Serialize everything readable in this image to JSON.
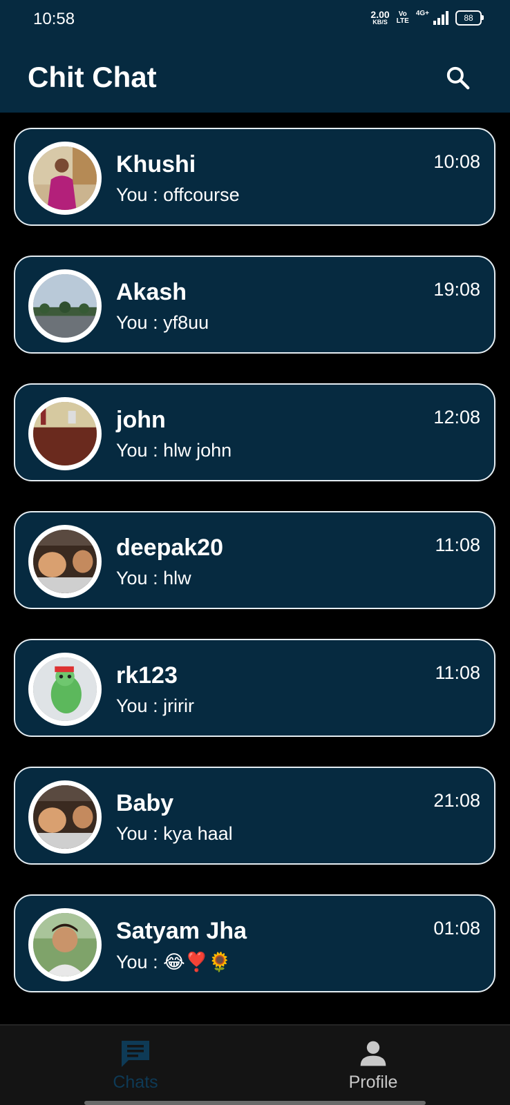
{
  "status_bar": {
    "time": "10:58",
    "net_speed_value": "2.00",
    "net_speed_unit": "KB/S",
    "volte_top": "Vo",
    "volte_bottom": "LTE",
    "network_type": "4G+",
    "battery_level": "88"
  },
  "header": {
    "title": "Chit Chat",
    "search_icon": "search-icon"
  },
  "chats": [
    {
      "name": "Khushi",
      "preview": "You : offcourse",
      "time": "10:08"
    },
    {
      "name": "Akash",
      "preview": "You : yf8uu",
      "time": "19:08"
    },
    {
      "name": "john",
      "preview": "You : hlw john",
      "time": "12:08"
    },
    {
      "name": "deepak20",
      "preview": "You : hlw",
      "time": "11:08"
    },
    {
      "name": "rk123",
      "preview": "You : jririr",
      "time": "11:08"
    },
    {
      "name": "Baby",
      "preview": "You : kya haal",
      "time": "21:08"
    },
    {
      "name": "Satyam Jha",
      "preview": "You : 😂❣️🌻",
      "time": "01:08"
    }
  ],
  "bottom_nav": {
    "chats_label": "Chats",
    "profile_label": "Profile",
    "active_tab": "Chats"
  },
  "colors": {
    "header_bg": "#062a40",
    "card_bg": "#062a40",
    "card_border": "#e6eef3",
    "screen_bg": "#000000",
    "nav_bg": "#141414",
    "nav_active": "#0e3a56",
    "nav_inactive": "#c8c8c8"
  }
}
